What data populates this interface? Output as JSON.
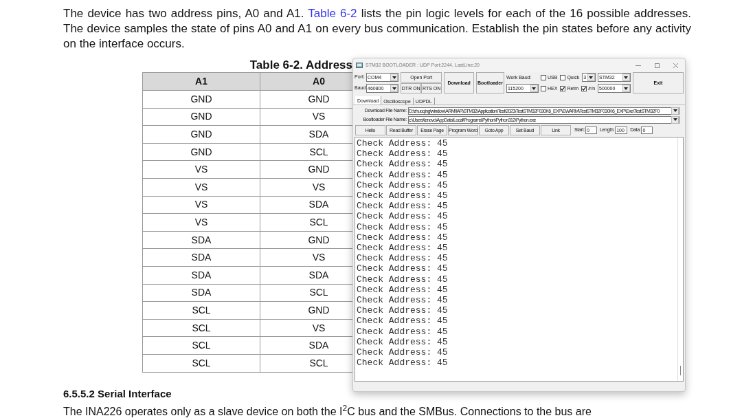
{
  "document": {
    "paragraph": {
      "before": "The device has two address pins, A0 and A1.",
      "link": "Table 6-2",
      "after": "lists the pin logic levels for each of the 16 possible addresses. The device samples the state of pins A0 and A1 on every bus communication. Establish the pin states before any activity on the interface occurs."
    },
    "table": {
      "title": "Table 6-2. Address",
      "columns": [
        "A1",
        "A0"
      ],
      "rows": [
        [
          "GND",
          "GND"
        ],
        [
          "GND",
          "VS"
        ],
        [
          "GND",
          "SDA"
        ],
        [
          "GND",
          "SCL"
        ],
        [
          "VS",
          "GND"
        ],
        [
          "VS",
          "VS"
        ],
        [
          "VS",
          "SDA"
        ],
        [
          "VS",
          "SCL"
        ],
        [
          "SDA",
          "GND"
        ],
        [
          "SDA",
          "VS"
        ],
        [
          "SDA",
          "SDA"
        ],
        [
          "SDA",
          "SCL"
        ],
        [
          "SCL",
          "GND"
        ],
        [
          "SCL",
          "VS"
        ],
        [
          "SCL",
          "SDA"
        ],
        [
          "SCL",
          "SCL"
        ]
      ]
    },
    "section_heading": "6.5.5.2 Serial Interface",
    "body_text": "The INA226 operates only as a slave device on both the I$^{2}$C bus and the SMBus. Connections to the bus are"
  },
  "window": {
    "title": "STM32 BOOTLOADER : UDP Port:2244, LastLine:20",
    "port": {
      "label": "Port:",
      "value": "COM4"
    },
    "baud": {
      "label": "Baud:",
      "value": "460800"
    },
    "open_port": "Open Port",
    "dtr": "DTR ON",
    "rts": "RTS ON",
    "download": "Download",
    "bootloader": "Bootloader",
    "work_baud": {
      "label": "Work Baud:",
      "value": "115200"
    },
    "checkboxes_top": [
      {
        "label": "USB",
        "checked": false
      },
      {
        "label": "Quick",
        "checked": false
      }
    ],
    "quick_value": "3",
    "checkboxes_bottom": [
      {
        "label": "HEX",
        "checked": false
      },
      {
        "label": "Retm",
        "checked": true
      },
      {
        "label": "/r/n",
        "checked": true
      }
    ],
    "chip": "STM32",
    "chip_baud": "500000",
    "exit": "Exit",
    "tabs": [
      {
        "label": "Download",
        "selected": true
      },
      {
        "label": "Oscilloscope",
        "selected": false
      },
      {
        "label": "UDPDL",
        "selected": false
      }
    ],
    "files": [
      {
        "label": "Download File Name:",
        "value": "D:\\zhuoqing\\window\\ARM\\IAR\\STM32\\Application\\Test\\2023\\TestSTM32F030K6_EXP\\EWARM\\TestSTM32F030K6_EXP\\Exe\\TestSTM32F0"
      },
      {
        "label": "Bootloader File Name:",
        "value": "c:\\Users\\lenovo\\AppData\\Local\\Programs\\Python\\Python312\\Python.exe"
      }
    ],
    "actions": [
      "Hello",
      "Read Buffer",
      "Erase Page",
      "Program Word",
      "Goto App",
      "Set Baud",
      "Link"
    ],
    "fields": [
      {
        "label": "Start:",
        "value": "0"
      },
      {
        "label": "Length:",
        "value": "100"
      },
      {
        "label": "Data:",
        "value": "0"
      }
    ],
    "output": [
      "Check Address: 45",
      "Check Address: 45",
      "Check Address: 45",
      "Check Address: 45",
      "Check Address: 45",
      "Check Address: 45",
      "Check Address: 45",
      "Check Address: 45",
      "Check Address: 45",
      "Check Address: 45",
      "Check Address: 45",
      "Check Address: 45",
      "Check Address: 45",
      "Check Address: 45",
      "Check Address: 45",
      "Check Address: 45",
      "Check Address: 45",
      "Check Address: 45",
      "Check Address: 45",
      "Check Address: 45",
      "Check Address: 45",
      "Check Address: 45"
    ]
  }
}
